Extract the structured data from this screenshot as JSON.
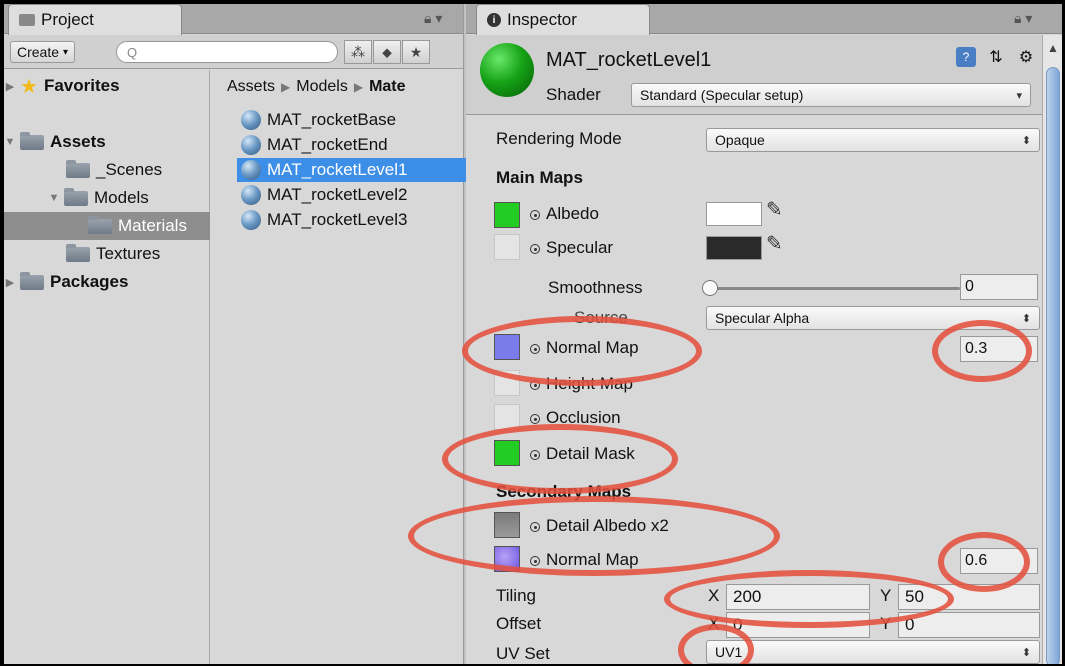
{
  "project": {
    "tab_label": "Project",
    "create_label": "Create",
    "search_placeholder": "Q",
    "tree": {
      "favorites": "Favorites",
      "assets": "Assets",
      "scenes": "_Scenes",
      "models": "Models",
      "materials": "Materials",
      "textures": "Textures",
      "packages": "Packages"
    },
    "breadcrumb": [
      "Assets",
      "Models",
      "Mate"
    ],
    "files": [
      "MAT_rocketBase",
      "MAT_rocketEnd",
      "MAT_rocketLevel1",
      "MAT_rocketLevel2",
      "MAT_rocketLevel3"
    ],
    "selected_file": "MAT_rocketLevel1"
  },
  "inspector": {
    "tab_label": "Inspector",
    "material_name": "MAT_rocketLevel1",
    "shader_label": "Shader",
    "shader_value": "Standard (Specular setup)",
    "rendering_mode_label": "Rendering Mode",
    "rendering_mode_value": "Opaque",
    "main_maps_header": "Main Maps",
    "albedo_label": "Albedo",
    "specular_label": "Specular",
    "smoothness_label": "Smoothness",
    "smoothness_value": "0",
    "smoothness_level": 0,
    "source_label": "Source",
    "source_value": "Specular Alpha",
    "normal_map_label": "Normal Map",
    "normal_map_value": "0.3",
    "height_map_label": "Height Map",
    "occlusion_label": "Occlusion",
    "detail_mask_label": "Detail Mask",
    "secondary_maps_header": "Secondary Maps",
    "detail_albedo_label": "Detail Albedo x2",
    "secondary_normal_label": "Normal Map",
    "secondary_normal_value": "0.6",
    "tiling_label": "Tiling",
    "tiling_x_label": "X",
    "tiling_x": "200",
    "tiling_y_label": "Y",
    "tiling_y": "50",
    "offset_label": "Offset",
    "offset_x_label": "X",
    "offset_x": "0",
    "offset_y_label": "Y",
    "offset_y": "0",
    "uv_set_label": "UV Set",
    "uv_set_value": "UV1"
  },
  "colors": {
    "selection": "#3d8ee6",
    "highlight_ellipse": "#e4503c",
    "albedo_swatch": "#ffffff",
    "specular_swatch": "#2a2a2a",
    "material_color": "#17a417"
  }
}
